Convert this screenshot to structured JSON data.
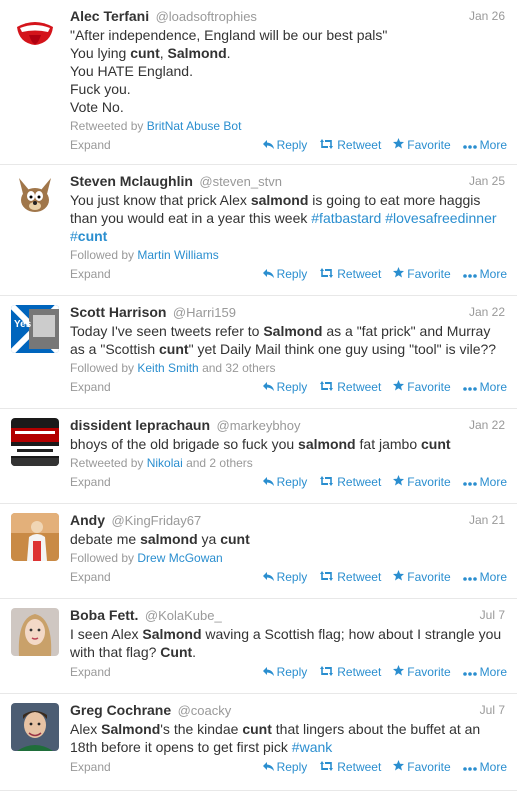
{
  "tweets": [
    {
      "name": "Alec Terfani",
      "handle": "@loadsoftrophies",
      "time": "Jan 26",
      "lines": [
        [
          {
            "t": "\"After independence, England will be our best pals\""
          }
        ],
        [
          {
            "t": "You lying "
          },
          {
            "t": "cunt",
            "b": true
          },
          {
            "t": ", "
          },
          {
            "t": "Salmond",
            "b": true
          },
          {
            "t": "."
          }
        ],
        [
          {
            "t": "You HATE England."
          }
        ],
        [
          {
            "t": "Fuck you."
          }
        ],
        [
          {
            "t": "Vote No."
          }
        ]
      ],
      "context_prefix": "Retweeted by ",
      "context_link": "BritNat Abuse Bot",
      "context_suffix": "",
      "avatar": "rolling-stones-tongue"
    },
    {
      "name": "Steven Mclaughlin",
      "handle": "@steven_stvn",
      "time": "Jan 25",
      "lines": [
        [
          {
            "t": "You just know that prick Alex "
          },
          {
            "t": "salmond",
            "b": true
          },
          {
            "t": " is going to eat more haggis"
          }
        ],
        [
          {
            "t": "than you would eat in a year this week "
          },
          {
            "t": "#fatbastard",
            "tag": true
          },
          {
            "t": " "
          },
          {
            "t": "#lovesafreedinner",
            "tag": true
          }
        ],
        [
          {
            "t": "#",
            "tag": true
          },
          {
            "t": "cunt",
            "tag": true,
            "b": true
          }
        ]
      ],
      "context_prefix": "Followed by ",
      "context_link": "Martin Williams",
      "context_suffix": "",
      "avatar": "coyote-cartoon"
    },
    {
      "name": "Scott Harrison",
      "handle": "@Harri159",
      "time": "Jan 22",
      "lines": [
        [
          {
            "t": "Today I've seen tweets refer to "
          },
          {
            "t": "Salmond",
            "b": true
          },
          {
            "t": " as a \"fat prick\" and Murray"
          }
        ],
        [
          {
            "t": "as a \"Scottish "
          },
          {
            "t": "cunt",
            "b": true
          },
          {
            "t": "\" yet Daily Mail think one guy using \"tool\" is vile??"
          }
        ]
      ],
      "context_prefix": "Followed by ",
      "context_link": "Keith Smith",
      "context_suffix": " and 32 others",
      "avatar": "yes-saltire"
    },
    {
      "name": "dissident leprachaun",
      "handle": "@markeybhoy",
      "time": "Jan 22",
      "lines": [
        [
          {
            "t": "bhoys of the old brigade so fuck you "
          },
          {
            "t": "salmond",
            "b": true
          },
          {
            "t": " fat jambo "
          },
          {
            "t": "cunt",
            "b": true
          }
        ]
      ],
      "context_prefix": "Retweeted by ",
      "context_link": "Nikolai",
      "context_suffix": " and 2 others",
      "avatar": "bohemians-banner"
    },
    {
      "name": "Andy",
      "handle": "@KingFriday67",
      "time": "Jan 21",
      "lines": [
        [
          {
            "t": "debate me "
          },
          {
            "t": "salmond",
            "b": true
          },
          {
            "t": " ya "
          },
          {
            "t": "cunt",
            "b": true
          }
        ]
      ],
      "context_prefix": "Followed by ",
      "context_link": "Drew McGowan",
      "context_suffix": "",
      "avatar": "figure-photo"
    },
    {
      "name": "Boba Fett.",
      "handle": "@KolaKube_",
      "time": "Jul 7",
      "lines": [
        [
          {
            "t": "I seen Alex "
          },
          {
            "t": "Salmond",
            "b": true
          },
          {
            "t": " waving a Scottish flag; how about I strangle you"
          }
        ],
        [
          {
            "t": "with that flag? "
          },
          {
            "t": "Cunt",
            "b": true
          },
          {
            "t": "."
          }
        ]
      ],
      "context_prefix": "",
      "context_link": "",
      "context_suffix": "",
      "avatar": "woman-portrait"
    },
    {
      "name": "Greg Cochrane",
      "handle": "@coacky",
      "time": "Jul 7",
      "lines": [
        [
          {
            "t": "Alex "
          },
          {
            "t": "Salmond",
            "b": true
          },
          {
            "t": "'s the kindae "
          },
          {
            "t": "cunt",
            "b": true
          },
          {
            "t": " that lingers about the buffet at an"
          }
        ],
        [
          {
            "t": "18th before it opens to get first pick "
          },
          {
            "t": "#wank",
            "tag": true
          }
        ]
      ],
      "context_prefix": "",
      "context_link": "",
      "context_suffix": "",
      "avatar": "man-portrait"
    }
  ],
  "labels": {
    "expand": "Expand",
    "reply": "Reply",
    "retweet": "Retweet",
    "favorite": "Favorite",
    "more": "More"
  },
  "icons": {
    "reply": "reply-arrow-icon",
    "retweet": "retweet-arrows-icon",
    "favorite": "star-icon",
    "more": "ellipsis-icon"
  },
  "colors": {
    "link": "#2a8ecf",
    "meta": "#999999",
    "text": "#333333",
    "divider": "#e8e8e8"
  }
}
